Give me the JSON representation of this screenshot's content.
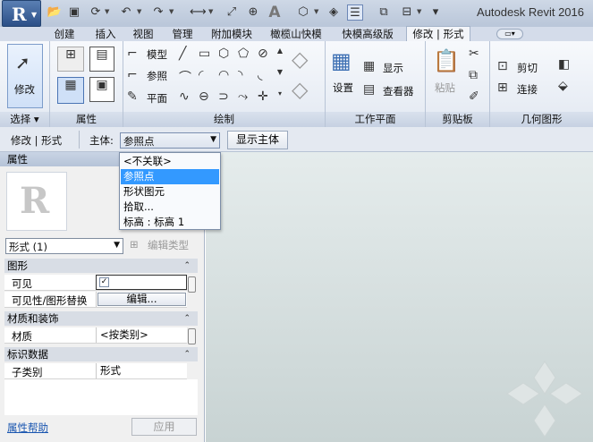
{
  "app_title": "Autodesk Revit 2016",
  "tabs": [
    {
      "label": "创建",
      "active": false
    },
    {
      "label": "插入",
      "active": false
    },
    {
      "label": "视图",
      "active": false
    },
    {
      "label": "管理",
      "active": false
    },
    {
      "label": "附加模块",
      "active": false
    },
    {
      "label": "橄榄山快模",
      "active": false
    },
    {
      "label": "快模高级版",
      "active": false
    },
    {
      "label": "修改 | 形式",
      "active": true
    }
  ],
  "ribbon": {
    "modify_label": "修改",
    "draw_items": {
      "model": "模型",
      "ref": "参照",
      "plane": "平面"
    },
    "workplane": {
      "set": "设置",
      "show": "显示",
      "viewer": "查看器"
    },
    "clipboard": {
      "paste": "粘贴"
    },
    "geometry": {
      "cut": "剪切",
      "join": "连接"
    },
    "panel_labels": {
      "select": "选择 ▾",
      "properties": "属性",
      "draw": "绘制",
      "workplane": "工作平面",
      "clipboard": "剪贴板",
      "geometry": "几何图形"
    }
  },
  "options_bar": {
    "context": "修改 | 形式",
    "host_label": "主体:",
    "host_value": "参照点",
    "show_host_button": "显示主体"
  },
  "dropdown_options": [
    {
      "label": "<不关联>",
      "selected": false
    },
    {
      "label": "参照点",
      "selected": true
    },
    {
      "label": "形状图元",
      "selected": false
    },
    {
      "label": "拾取...",
      "selected": false
    },
    {
      "label": "标高 : 标高 1",
      "selected": false
    }
  ],
  "properties": {
    "title": "属性",
    "type_selector": "形式 (1)",
    "edit_type": "编辑类型",
    "sections": {
      "graphics": "图形",
      "materials": "材质和装饰",
      "identity": "标识数据"
    },
    "rows": {
      "visible": "可见",
      "visibility_override": "可见性/图形替换",
      "edit_button": "编辑...",
      "material": "材质",
      "material_value": "<按类别>",
      "subcategory": "子类别",
      "subcategory_value": "形式"
    },
    "help_link": "属性帮助",
    "apply_button": "应用"
  },
  "colors": {
    "selection": "#3399ff",
    "active_tab": "#f3f5f9",
    "canvas_top": "#e5ecec"
  }
}
